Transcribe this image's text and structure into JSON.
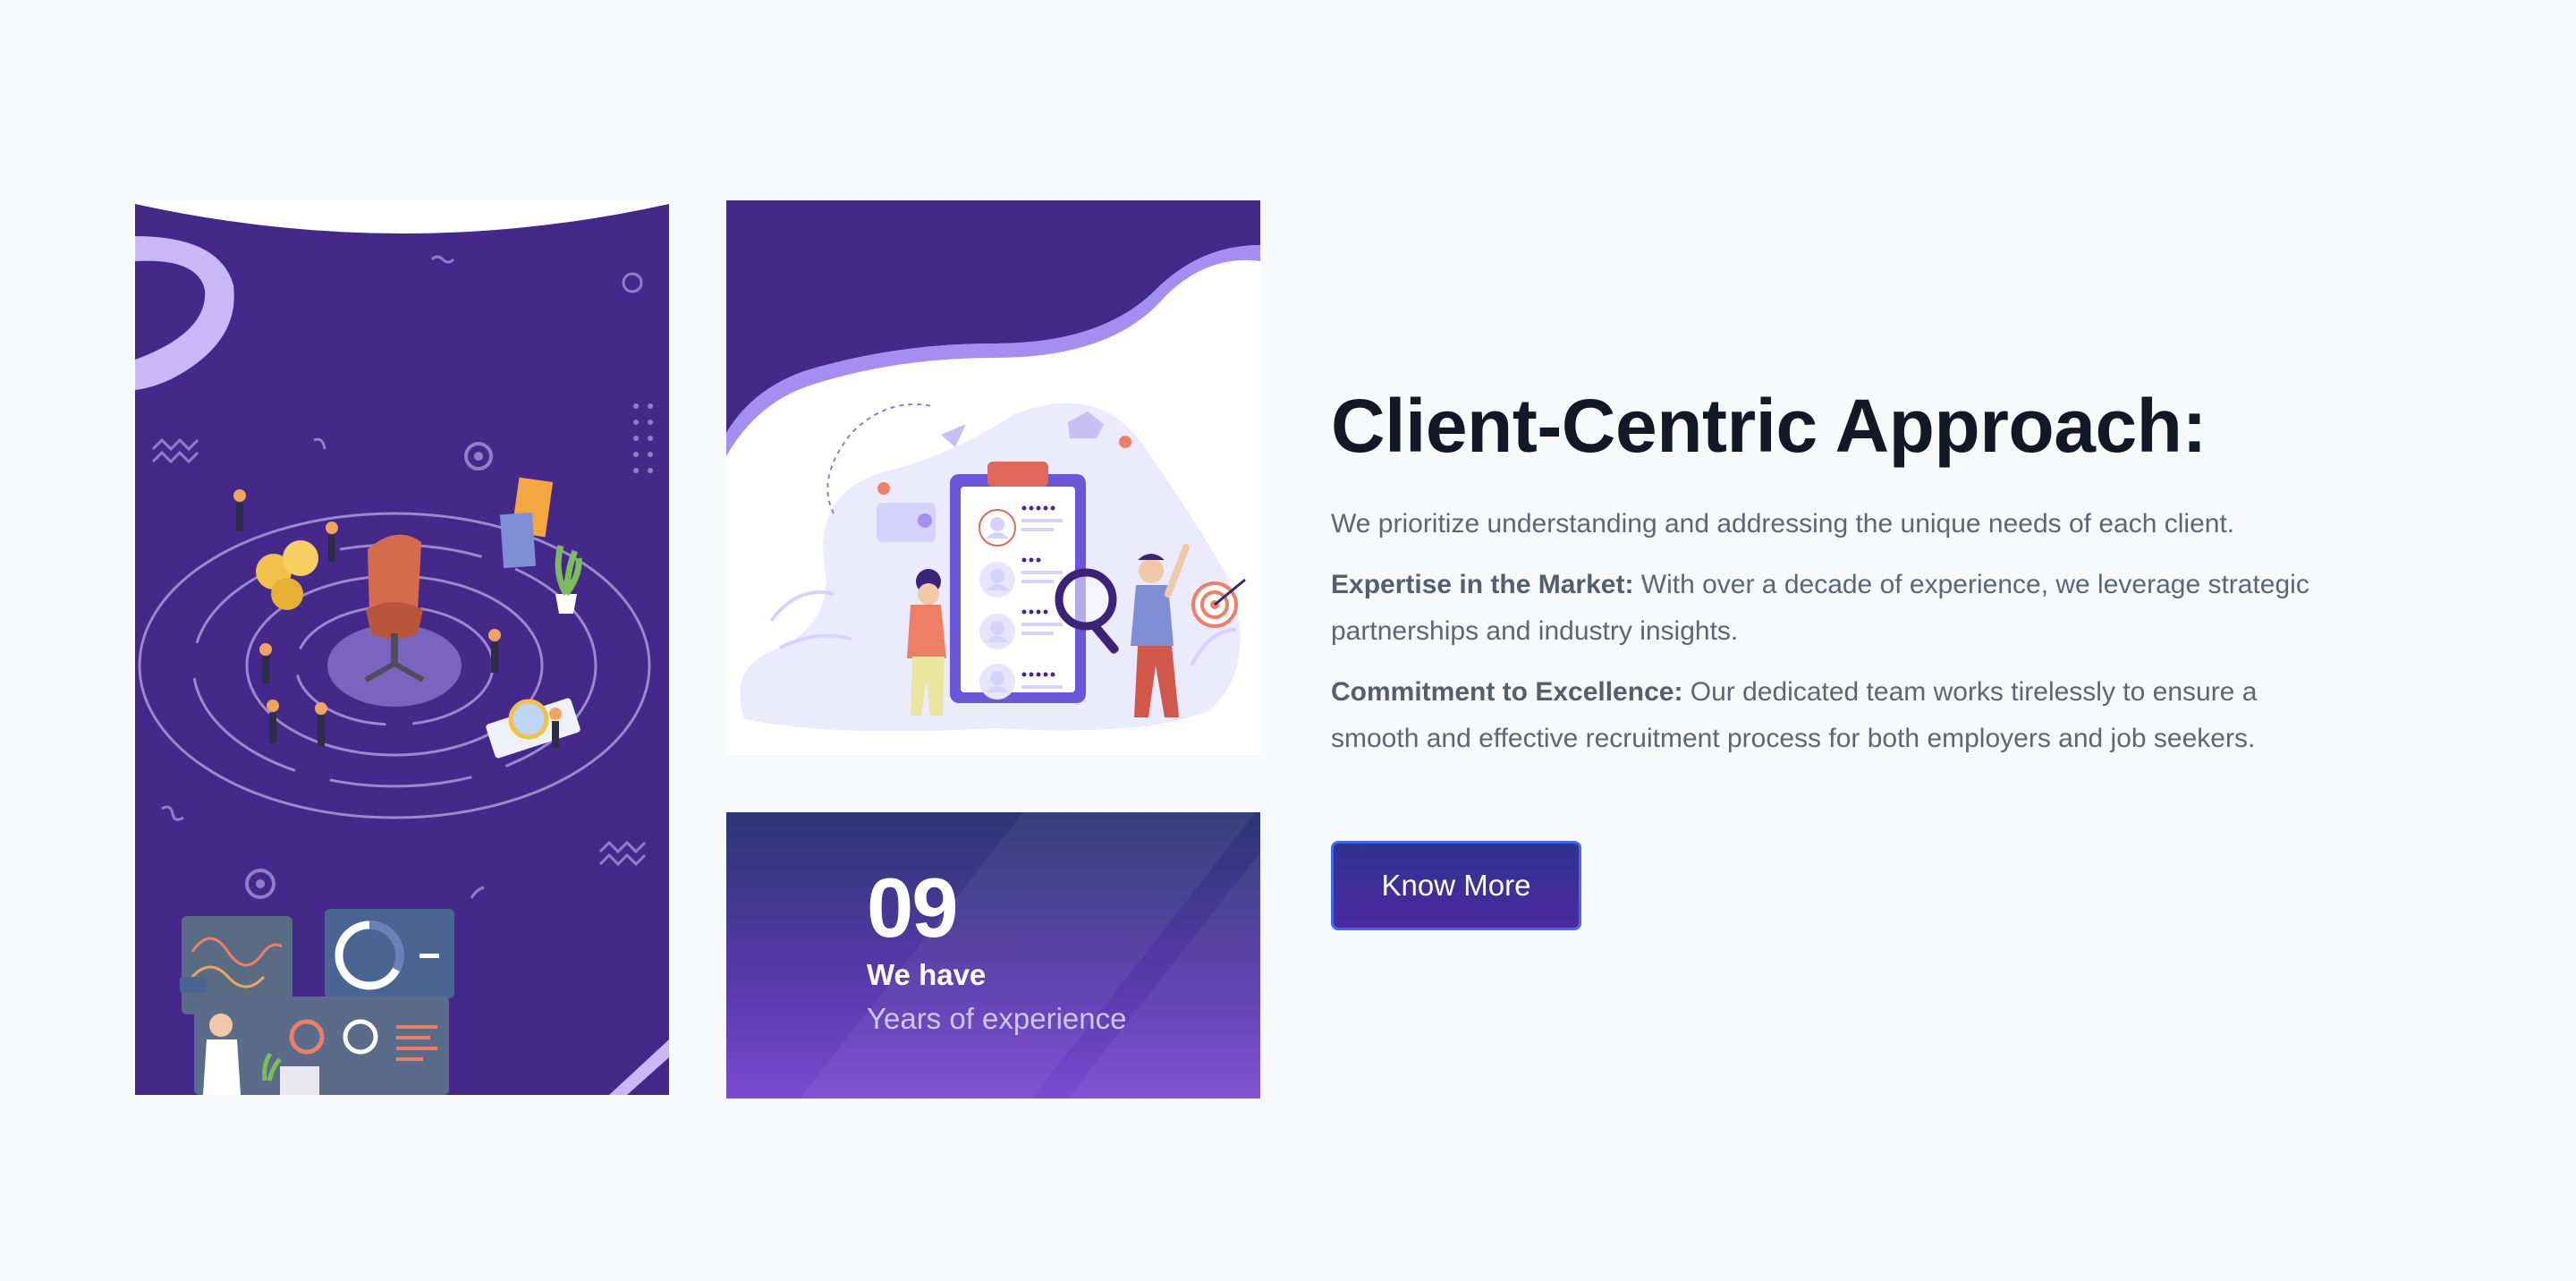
{
  "heading": "Client-Centric Approach:",
  "intro": "We prioritize understanding and addressing the unique needs of each client.",
  "expertise": {
    "label": "Expertise in the Market:",
    "text": " With over a decade of experience, we leverage strategic partnerships and industry insights."
  },
  "commitment": {
    "label": "Commitment to Excellence:",
    "text": " Our dedicated team works tirelessly to ensure a smooth and effective recruitment process for both employers and job seekers."
  },
  "cta_label": "Know More",
  "stat": {
    "number": "09",
    "label": "We have",
    "sub": "Years of experience"
  },
  "colors": {
    "brand_purple": "#44298a",
    "accent_lavender": "#c8b8f7",
    "heading": "#121826",
    "body_text": "#5d6675",
    "button_border": "#3f69f0"
  },
  "illustrations": [
    "recruitment-target-illustration",
    "candidate-clipboard-illustration"
  ]
}
